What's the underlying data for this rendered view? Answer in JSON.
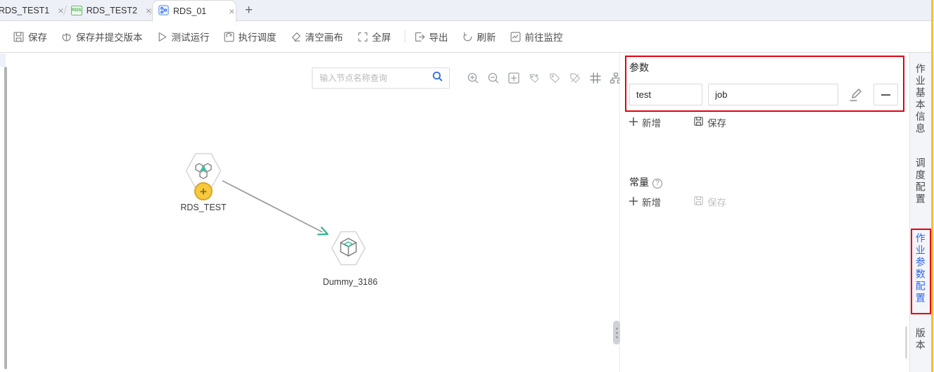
{
  "tab_bar": {
    "tabs": [
      {
        "label": "RDS_TEST1",
        "close": "×"
      },
      {
        "label": "RDS_TEST2",
        "close": "×",
        "badge": "RDS"
      },
      {
        "label": "RDS_01",
        "close": "×"
      }
    ],
    "new_tab": "+"
  },
  "toolbar": {
    "items": [
      {
        "label": "保存"
      },
      {
        "label": "保存并提交版本"
      },
      {
        "label": "测试运行"
      },
      {
        "label": "执行调度"
      },
      {
        "label": "清空画布"
      },
      {
        "label": "全屏"
      },
      {
        "label": "导出"
      },
      {
        "label": "刷新"
      },
      {
        "label": "前往监控"
      }
    ]
  },
  "canvas": {
    "search": {
      "placeholder": "输入节点名称查询"
    },
    "tools": [
      "zoom-in",
      "zoom-out",
      "fit-view",
      "add-tag",
      "tag",
      "hide-tag",
      "grid",
      "auto-layout"
    ],
    "nodes": [
      {
        "label": "RDS_TEST"
      },
      {
        "label": "Dummy_3186"
      }
    ]
  },
  "params_panel": {
    "title": "参数",
    "rows": [
      {
        "name": "test",
        "value": "job"
      }
    ],
    "add_label": "新增",
    "save_label": "保存",
    "constants_title": "常量",
    "help_glyph": "?",
    "const_add_label": "新增",
    "const_save_label": "保存"
  },
  "side_tabs": {
    "items": [
      {
        "label": "作业基本信息"
      },
      {
        "label": "调度配置"
      },
      {
        "label": "作业参数配置"
      },
      {
        "label": "版本"
      }
    ]
  },
  "colors": {
    "annotation_red": "#e60012",
    "accent_blue": "#3366f0",
    "node_teal": "#2fb392",
    "plus_badge_yellow": "#f7ca3e"
  }
}
